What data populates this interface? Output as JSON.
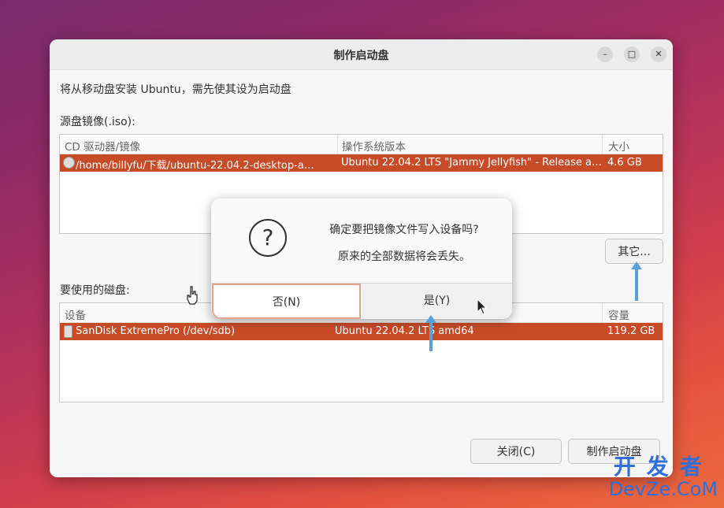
{
  "window": {
    "title": "制作启动盘",
    "controls": {
      "minimize": "–",
      "maximize": "□",
      "close": "✕"
    }
  },
  "intro": "将从移动盘安装 Ubuntu，需先使其设为启动盘",
  "source": {
    "label": "源盘镜像(.iso):",
    "columns": [
      "CD 驱动器/镜像",
      "操作系统版本",
      "大小"
    ],
    "row": {
      "path": "/home/billyfu/下载/ubuntu-22.04.2-desktop-a…",
      "os": "Ubuntu 22.04.2 LTS \"Jammy Jellyfish\" - Release a…",
      "size": "4.6 GB"
    },
    "other_button": "其它..."
  },
  "disk": {
    "label": "要使用的磁盘:",
    "columns": [
      "设备",
      "",
      "容量"
    ],
    "row": {
      "device": "SanDisk ExtremePro (/dev/sdb)",
      "os": "Ubuntu 22.04.2 LTS amd64",
      "size": "119.2 GB"
    }
  },
  "buttons": {
    "close": "关闭(C)",
    "make": "制作启动盘"
  },
  "dialog": {
    "line1": "确定要把镜像文件写入设备吗?",
    "line2": "原来的全部数据将会丢失。",
    "no": "否(N)",
    "yes": "是(Y)",
    "icon": "question-icon"
  },
  "watermark": {
    "line1": "开发者",
    "line2": "DevZe.CoM"
  },
  "colors": {
    "selection": "#c84b27",
    "arrow": "#5aa0d6",
    "watermark": "#2f6fd6"
  }
}
